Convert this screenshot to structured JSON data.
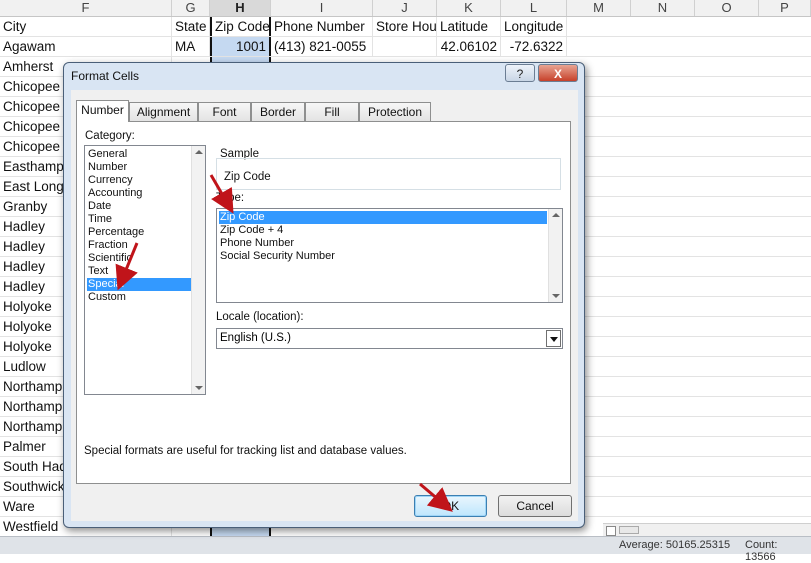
{
  "spreadsheet": {
    "columns": [
      "F",
      "G",
      "H",
      "I",
      "J",
      "K",
      "L",
      "M",
      "N",
      "O",
      "P"
    ],
    "selected_column": "H",
    "header_row": {
      "city": "City",
      "state": "State",
      "zip": "Zip Code",
      "phone": "Phone Number",
      "store_hours": "Store Hou",
      "latitude": "Latitude",
      "longitude": "Longitude"
    },
    "first_row": {
      "city": "Agawam",
      "state": "MA",
      "zip": "1001",
      "phone": "(413) 821-0055",
      "latitude": "42.06102",
      "longitude": "-72.6322"
    },
    "cities": [
      "Amherst",
      "Chicopee",
      "Chicopee",
      "Chicopee",
      "Chicopee",
      "Easthamp",
      "East Longm",
      "Granby",
      "Hadley",
      "Hadley",
      "Hadley",
      "Hadley",
      "Holyoke",
      "Holyoke",
      "Holyoke",
      "Ludlow",
      "Northamp",
      "Northamp",
      "Northamp",
      "Palmer",
      "South Had",
      "Southwick",
      "Ware",
      "Westfield"
    ],
    "status": {
      "average": "Average: 50165.25315",
      "count": "Count: 13566"
    }
  },
  "dialog": {
    "title": "Format Cells",
    "help_label": "?",
    "close_label": "X",
    "tabs": [
      "Number",
      "Alignment",
      "Font",
      "Border",
      "Fill",
      "Protection"
    ],
    "active_tab": "Number",
    "category_label": "Category:",
    "categories": [
      "General",
      "Number",
      "Currency",
      "Accounting",
      "Date",
      "Time",
      "Percentage",
      "Fraction",
      "Scientific",
      "Text",
      "Special",
      "Custom"
    ],
    "selected_category": "Special",
    "sample_label": "Sample",
    "sample_value": "Zip Code",
    "type_label": "Type:",
    "types": [
      "Zip Code",
      "Zip Code + 4",
      "Phone Number",
      "Social Security Number"
    ],
    "selected_type": "Zip Code",
    "locale_label": "Locale (location):",
    "locale_value": "English (U.S.)",
    "description": "Special formats are useful for tracking list and database values.",
    "ok_label": "OK",
    "cancel_label": "Cancel"
  },
  "colors": {
    "selection": "#3399ff",
    "dialog_frame": "#d9e5f3",
    "annotation_arrow": "#c0141a"
  }
}
